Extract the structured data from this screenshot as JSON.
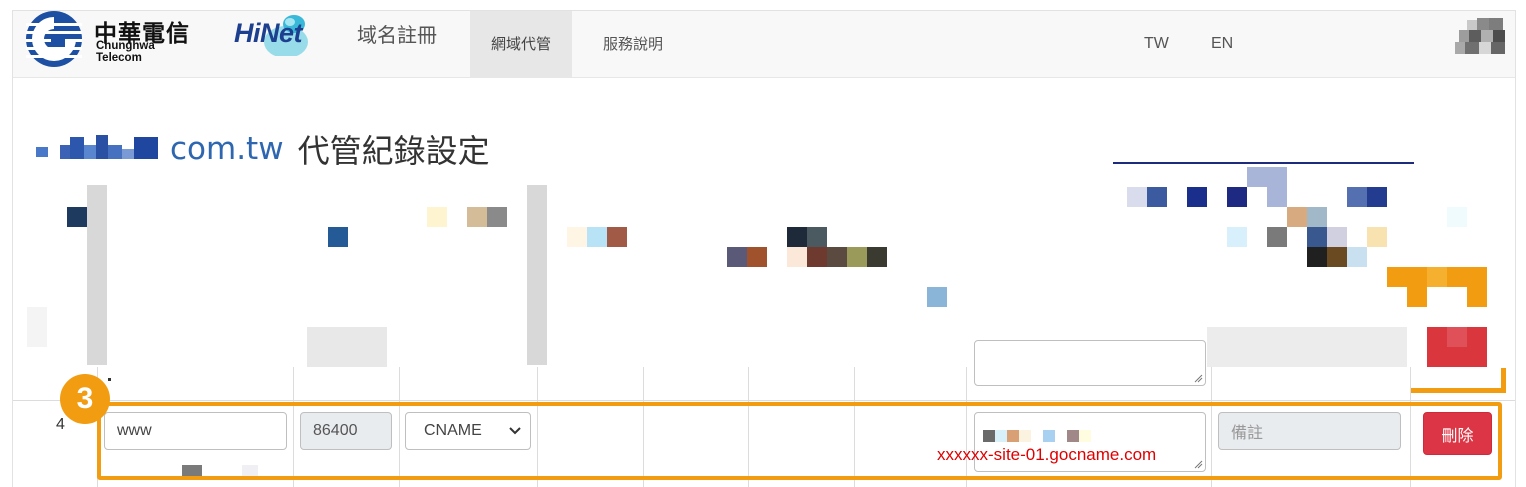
{
  "header": {
    "brand_zh": "中華電信",
    "brand_en": "Chunghwa Telecom",
    "hinet_logo": "HiNet",
    "domain_registration": "域名註冊",
    "nav": [
      {
        "label": "網域代管",
        "active": true
      },
      {
        "label": "服務說明",
        "active": false
      }
    ],
    "lang_tw": "TW",
    "lang_en": "EN"
  },
  "page": {
    "domain_suffix": "com.tw",
    "title": "代管紀錄設定"
  },
  "record_row": {
    "number": "4",
    "host": "www",
    "ttl": "86400",
    "type": "CNAME",
    "value": "xxxxxx-site-01.gocname.com",
    "note_placeholder": "備註",
    "delete_label": "刪除"
  },
  "annotation": {
    "step": "3"
  },
  "colors": {
    "brand_blue": "#2e67b0",
    "highlight": "#f29c11",
    "danger": "#dc3545",
    "value_text": "#e00000"
  },
  "icons": {
    "cht_logo": "chunghwa-telecom-logo-icon",
    "hinet_logo": "hinet-logo-icon",
    "select_chevron": "chevron-down-icon",
    "resize": "resize-grip-icon"
  }
}
